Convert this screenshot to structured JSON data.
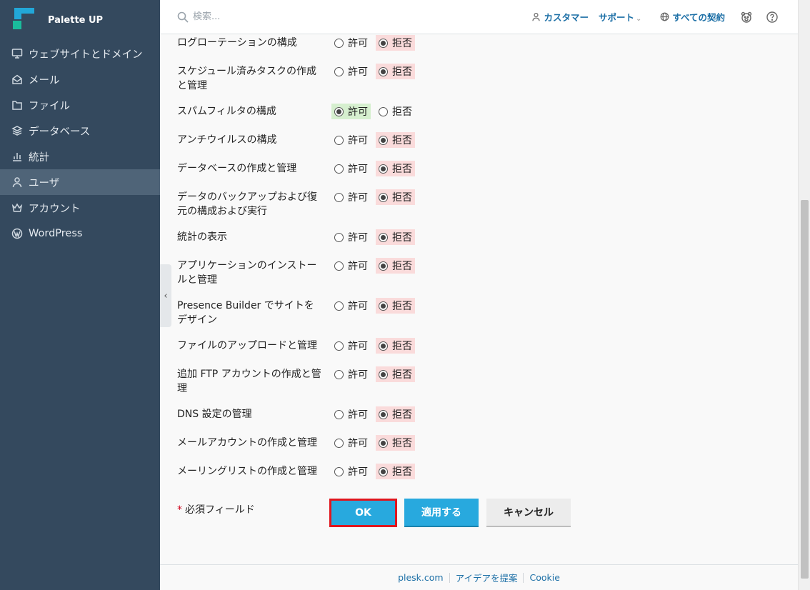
{
  "brand": {
    "name": "Palette UP"
  },
  "sidebar": {
    "items": [
      {
        "label": "ウェブサイトとドメイン",
        "icon": "monitor-icon",
        "active": false
      },
      {
        "label": "メール",
        "icon": "mail-icon",
        "active": false
      },
      {
        "label": "ファイル",
        "icon": "folder-icon",
        "active": false
      },
      {
        "label": "データベース",
        "icon": "database-icon",
        "active": false
      },
      {
        "label": "統計",
        "icon": "bar-chart-icon",
        "active": false
      },
      {
        "label": "ユーザ",
        "icon": "user-icon",
        "active": true
      },
      {
        "label": "アカウント",
        "icon": "crown-icon",
        "active": false
      },
      {
        "label": "WordPress",
        "icon": "wordpress-icon",
        "active": false
      }
    ]
  },
  "header": {
    "search_placeholder": "検索...",
    "customer": "カスタマー",
    "support": "サポート",
    "subscriptions": "すべての契約"
  },
  "permissions": {
    "allow_label": "許可",
    "deny_label": "拒否",
    "rows": [
      {
        "label": "ログローテーションの構成",
        "value": "deny"
      },
      {
        "label": "スケジュール済みタスクの作成と管理",
        "value": "deny"
      },
      {
        "label": "スパムフィルタの構成",
        "value": "allow"
      },
      {
        "label": "アンチウイルスの構成",
        "value": "deny"
      },
      {
        "label": "データベースの作成と管理",
        "value": "deny"
      },
      {
        "label": "データのバックアップおよび復元の構成および実行",
        "value": "deny"
      },
      {
        "label": "統計の表示",
        "value": "deny"
      },
      {
        "label": "アプリケーションのインストールと管理",
        "value": "deny"
      },
      {
        "label": "Presence Builder でサイトをデザイン",
        "value": "deny"
      },
      {
        "label": "ファイルのアップロードと管理",
        "value": "deny"
      },
      {
        "label": "追加 FTP アカウントの作成と管理",
        "value": "deny"
      },
      {
        "label": "DNS 設定の管理",
        "value": "deny"
      },
      {
        "label": "メールアカウントの作成と管理",
        "value": "deny"
      },
      {
        "label": "メーリングリストの作成と管理",
        "value": "deny"
      }
    ]
  },
  "form": {
    "required_star": "*",
    "required_label": "必須フィールド",
    "ok_label": "OK",
    "apply_label": "適用する",
    "cancel_label": "キャンセル"
  },
  "footer": {
    "links": [
      "plesk.com",
      "アイデアを提案",
      "Cookie"
    ]
  },
  "colors": {
    "sidebar_bg": "#34495e",
    "accent": "#28a9de",
    "deny_highlight": "#fadbdb",
    "allow_highlight": "#d6efcf",
    "ok_outline": "#e0161e"
  }
}
